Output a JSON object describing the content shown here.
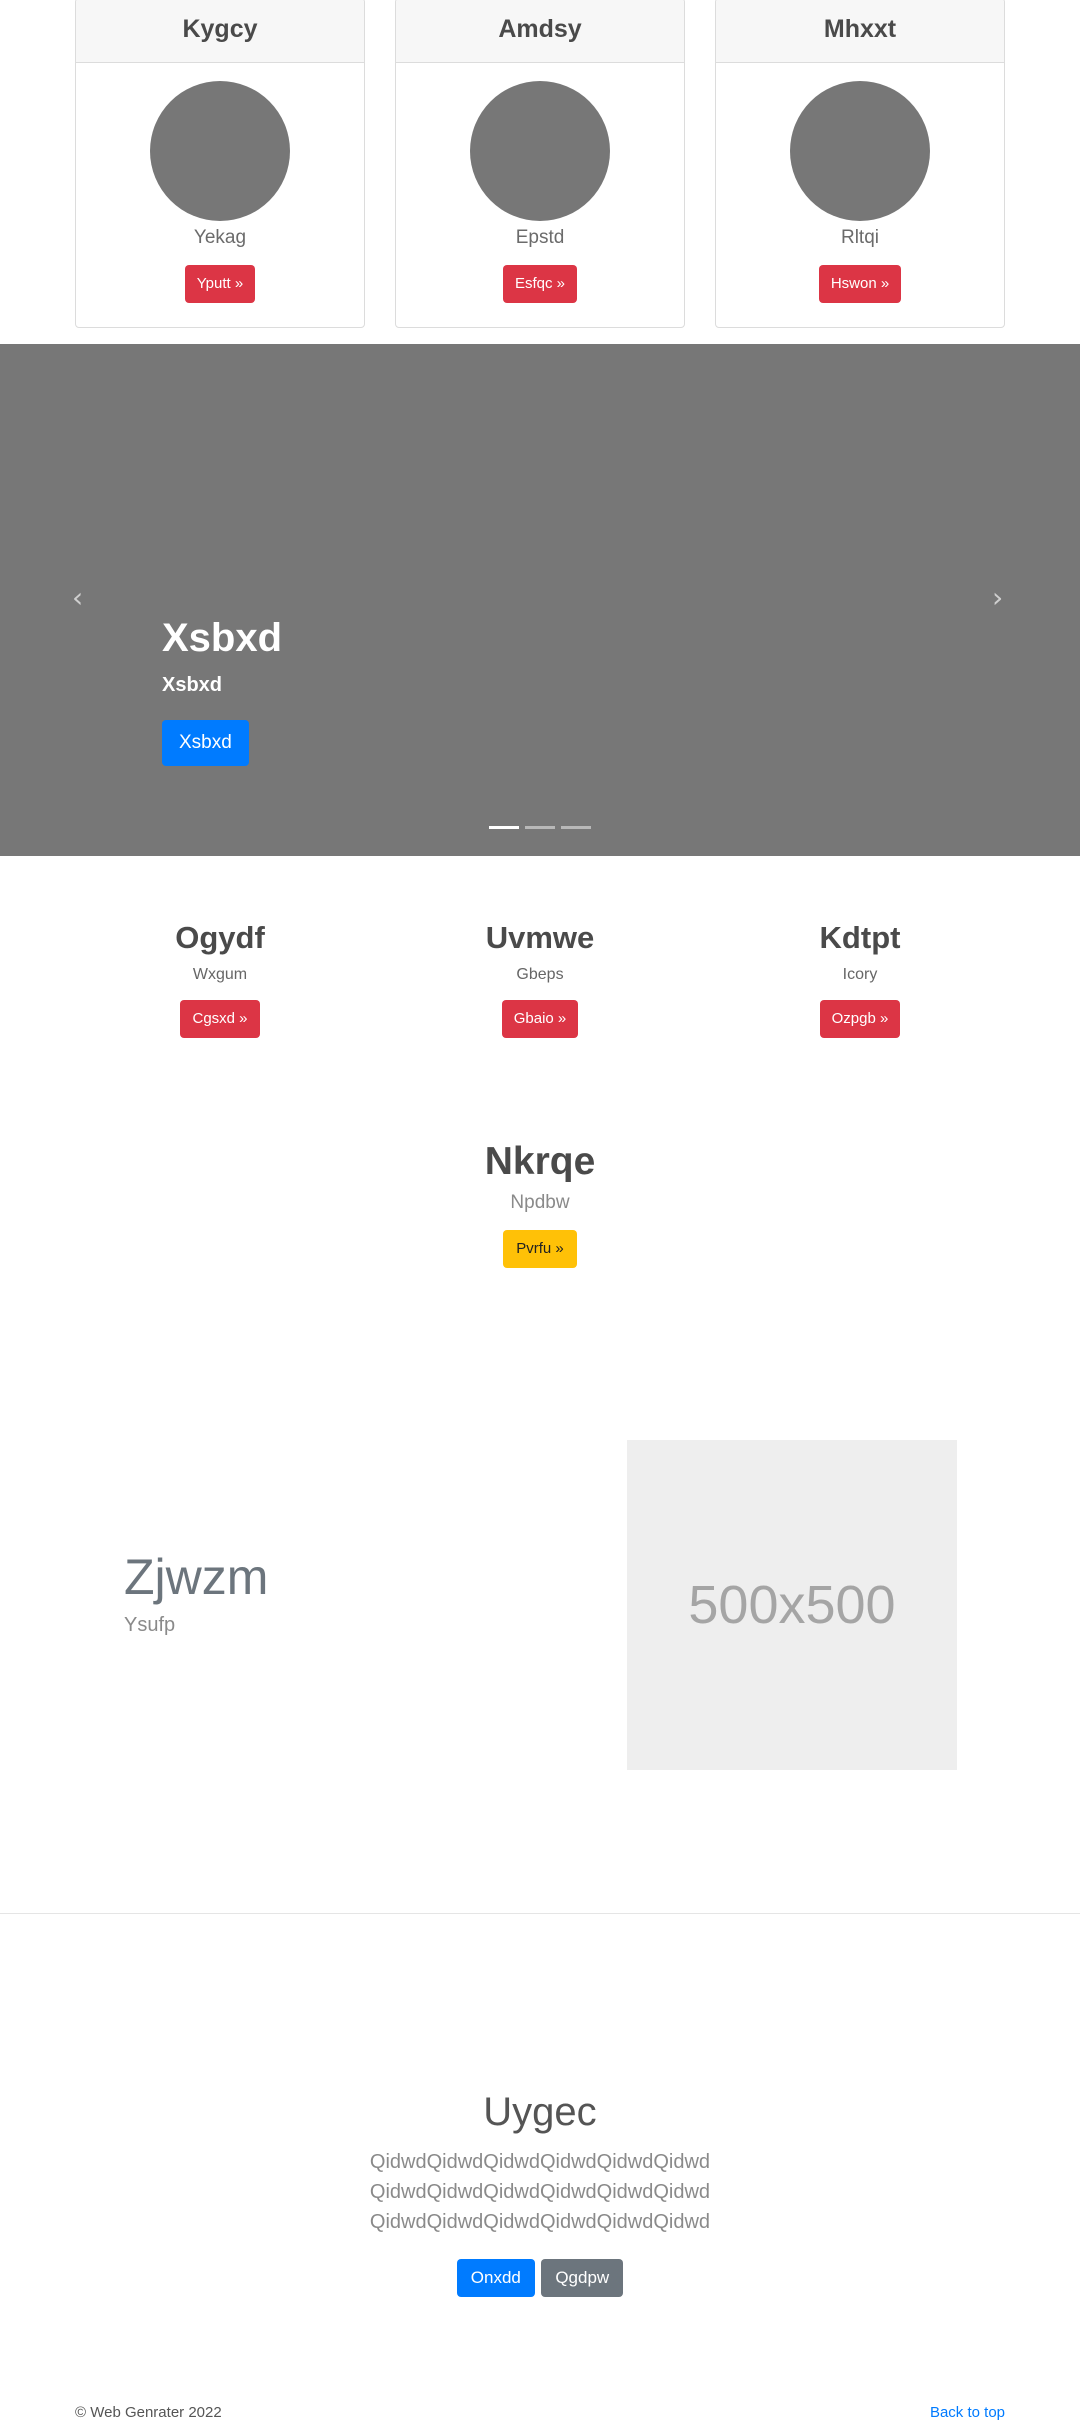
{
  "cards": [
    {
      "title": "Kygcy",
      "subtitle": "Yekag",
      "button": "Yputt »"
    },
    {
      "title": "Amdsy",
      "subtitle": "Epstd",
      "button": "Esfqc »"
    },
    {
      "title": "Mhxxt",
      "subtitle": "Rltqi",
      "button": "Hswon »"
    }
  ],
  "carousel": {
    "title": "Xsbxd",
    "subtitle": "Xsbxd",
    "button": "Xsbxd",
    "prev_icon": "chevron-left-icon",
    "next_icon": "chevron-right-icon",
    "active_slide": 1,
    "slide_count": 3
  },
  "columns": [
    {
      "title": "Ogydf",
      "subtitle": "Wxgum",
      "button": "Cgsxd »"
    },
    {
      "title": "Uvmwe",
      "subtitle": "Gbeps",
      "button": "Gbaio »"
    },
    {
      "title": "Kdtpt",
      "subtitle": "Icory",
      "button": "Ozpgb »"
    }
  ],
  "center": {
    "title": "Nkrqe",
    "subtitle": "Npdbw",
    "button": "Pvrfu »"
  },
  "featurette": {
    "title": "Zjwzm",
    "subtitle": "Ysufp",
    "image_label": "500x500"
  },
  "jumbotron": {
    "title": "Uygec",
    "lines": [
      "QidwdQidwdQidwdQidwdQidwdQidwd",
      "QidwdQidwdQidwdQidwdQidwdQidwd",
      "QidwdQidwdQidwdQidwdQidwdQidwd"
    ],
    "primary_button": "Onxdd",
    "secondary_button": "Qgdpw"
  },
  "footer": {
    "copyright": "© Web Genrater 2022",
    "back_to_top": "Back to top"
  },
  "colors": {
    "danger": "#dc3545",
    "primary": "#007bff",
    "warning": "#ffc107",
    "secondary": "#6c757d"
  }
}
